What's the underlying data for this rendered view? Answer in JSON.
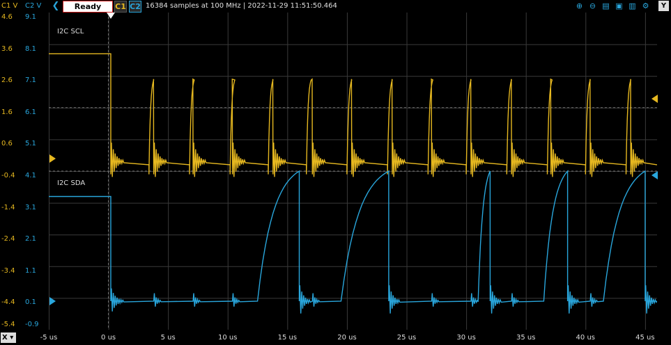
{
  "header": {
    "c1_axis_label": "C1 V",
    "c2_axis_label": "C2 V",
    "status": "Ready",
    "channel1_button": "C1",
    "channel2_button": "C2",
    "acquisition_info": "16384 samples at 100 MHz | 2022-11-29 11:51:50.464",
    "y_button": "Y",
    "x_button": "X"
  },
  "toolbar_icons": [
    "zoom-in-icon",
    "zoom-out-icon",
    "align-top-icon",
    "align-middle-icon",
    "align-bottom-icon",
    "settings-icon"
  ],
  "axes": {
    "c1_ticks": [
      "4.6",
      "3.6",
      "2.6",
      "1.6",
      "0.6",
      "-0.4",
      "-1.4",
      "-2.4",
      "-3.4",
      "-4.4",
      "-5.4"
    ],
    "c2_ticks": [
      "9.1",
      "8.1",
      "7.1",
      "6.1",
      "5.1",
      "4.1",
      "3.1",
      "2.1",
      "1.1",
      "0.1",
      "-0.9"
    ],
    "x_ticks": [
      "-5 us",
      "0 us",
      "5 us",
      "10 us",
      "15 us",
      "20 us",
      "25 us",
      "30 us",
      "35 us",
      "40 us",
      "45 us"
    ]
  },
  "channels": {
    "c1": {
      "label": "I2C SCL",
      "color": "#e6b820"
    },
    "c2": {
      "label": "I2C SDA",
      "color": "#29a6dc"
    }
  },
  "chart_data": {
    "type": "line",
    "xlabel": "",
    "ylabel": "",
    "x_unit": "us",
    "xlim": [
      -5,
      46
    ],
    "grid": true,
    "trigger_time": 0,
    "series": [
      {
        "name": "I2C SCL",
        "axis": "C1 V",
        "ylim": [
          -5.4,
          4.6
        ],
        "idle_level": 3.3,
        "low_level": -0.5,
        "high_peak": 2.6,
        "pulse_rise_times_us": [
          3.4,
          6.8,
          10.2,
          13.4,
          16.6,
          20.0,
          23.4,
          26.8,
          30.0,
          33.4,
          36.8,
          40.0,
          43.4
        ],
        "pulse_fall_times_us": [
          0.2,
          3.8,
          7.1,
          10.4,
          13.8,
          17.1,
          20.4,
          23.8,
          27.1,
          30.4,
          33.8,
          37.1,
          40.4,
          43.8
        ]
      },
      {
        "name": "I2C SDA",
        "axis": "C2 V",
        "ylim": [
          -0.9,
          9.1
        ],
        "idle_level": 3.3,
        "low_level": 0.0,
        "high_peak": 4.1,
        "rise_start_times_us": [
          12.5,
          19.5,
          31.0,
          36.5,
          41.5
        ],
        "fall_times_us": [
          16.0,
          23.5,
          32.0,
          38.5,
          45.0
        ]
      }
    ]
  }
}
